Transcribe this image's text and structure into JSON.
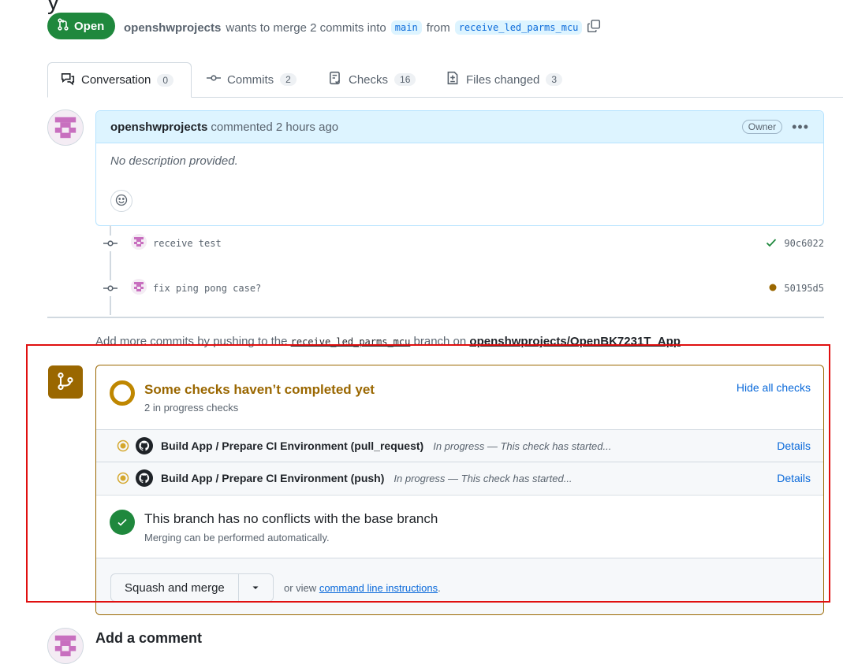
{
  "pr": {
    "state": "Open",
    "author": "openshwprojects",
    "summary_middle": "wants to merge 2 commits into",
    "base_branch": "main",
    "from_word": "from",
    "head_branch": "receive_led_parms_mcu"
  },
  "tabs": [
    {
      "label": "Conversation",
      "count": "0"
    },
    {
      "label": "Commits",
      "count": "2"
    },
    {
      "label": "Checks",
      "count": "16"
    },
    {
      "label": "Files changed",
      "count": "3"
    }
  ],
  "comment": {
    "author": "openshwprojects",
    "action": "commented 2 hours ago",
    "role": "Owner",
    "body": "No description provided."
  },
  "commits": [
    {
      "message": "receive test",
      "sha": "90c6022",
      "status": "success"
    },
    {
      "message": "fix ping pong case?",
      "sha": "50195d5",
      "status": "pending"
    }
  ],
  "add_commits": {
    "prefix": "Add more commits by pushing to the",
    "branch": "receive_led_parms_mcu",
    "middle": "branch on",
    "repo": "openshwprojects/OpenBK7231T_App",
    "suffix": "."
  },
  "checks": {
    "title": "Some checks haven’t completed yet",
    "subtitle": "2 in progress checks",
    "hide_link": "Hide all checks",
    "rows": [
      {
        "name": "Build App / Prepare CI Environment (pull_request)",
        "desc": "In progress — This check has started...",
        "details": "Details"
      },
      {
        "name": "Build App / Prepare CI Environment (push)",
        "desc": "In progress — This check has started...",
        "details": "Details"
      }
    ]
  },
  "conflicts": {
    "title": "This branch has no conflicts with the base branch",
    "subtitle": "Merging can be performed automatically."
  },
  "merge": {
    "button": "Squash and merge",
    "or_view": "or view",
    "cli_link": "command line instructions",
    "period": "."
  },
  "add_comment": "Add a comment",
  "colors": {
    "open_green": "#1f883d",
    "pending_amber": "#9a6700",
    "link_blue": "#0969da",
    "highlight_red": "#e01010"
  }
}
